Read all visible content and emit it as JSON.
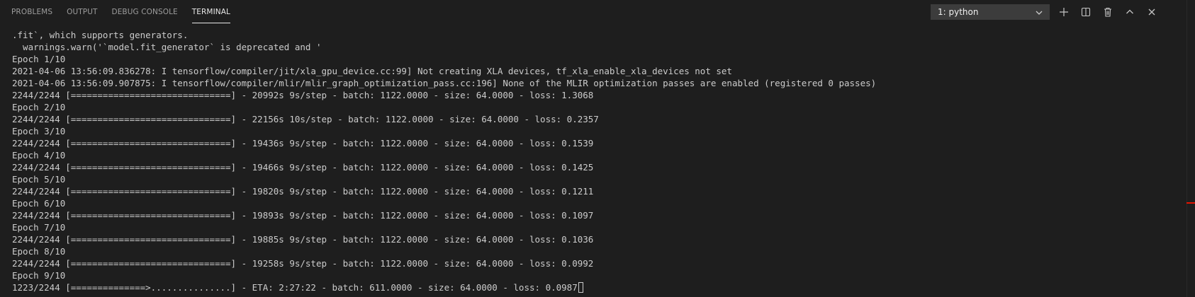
{
  "panel": {
    "tabs": [
      {
        "label": "PROBLEMS"
      },
      {
        "label": "OUTPUT"
      },
      {
        "label": "DEBUG CONSOLE"
      },
      {
        "label": "TERMINAL"
      }
    ],
    "active_tab": "TERMINAL",
    "terminal_select": {
      "selected": "1: python"
    },
    "actions": [
      {
        "name": "new-terminal",
        "icon": "plus-icon"
      },
      {
        "name": "split-terminal",
        "icon": "split-icon"
      },
      {
        "name": "kill-terminal",
        "icon": "trash-icon"
      },
      {
        "name": "maximize-panel",
        "icon": "chevron-up-icon"
      },
      {
        "name": "close-panel",
        "icon": "close-icon"
      }
    ]
  },
  "terminal": {
    "lines": [
      ".fit`, which supports generators.",
      "  warnings.warn('`model.fit_generator` is deprecated and '",
      "Epoch 1/10",
      "2021-04-06 13:56:09.836278: I tensorflow/compiler/jit/xla_gpu_device.cc:99] Not creating XLA devices, tf_xla_enable_xla_devices not set",
      "2021-04-06 13:56:09.907875: I tensorflow/compiler/mlir/mlir_graph_optimization_pass.cc:196] None of the MLIR optimization passes are enabled (registered 0 passes)",
      "2244/2244 [==============================] - 20992s 9s/step - batch: 1122.0000 - size: 64.0000 - loss: 1.3068",
      "Epoch 2/10",
      "2244/2244 [==============================] - 22156s 10s/step - batch: 1122.0000 - size: 64.0000 - loss: 0.2357",
      "Epoch 3/10",
      "2244/2244 [==============================] - 19436s 9s/step - batch: 1122.0000 - size: 64.0000 - loss: 0.1539",
      "Epoch 4/10",
      "2244/2244 [==============================] - 19466s 9s/step - batch: 1122.0000 - size: 64.0000 - loss: 0.1425",
      "Epoch 5/10",
      "2244/2244 [==============================] - 19820s 9s/step - batch: 1122.0000 - size: 64.0000 - loss: 0.1211",
      "Epoch 6/10",
      "2244/2244 [==============================] - 19893s 9s/step - batch: 1122.0000 - size: 64.0000 - loss: 0.1097",
      "Epoch 7/10",
      "2244/2244 [==============================] - 19885s 9s/step - batch: 1122.0000 - size: 64.0000 - loss: 0.1036",
      "Epoch 8/10",
      "2244/2244 [==============================] - 19258s 9s/step - batch: 1122.0000 - size: 64.0000 - loss: 0.0992",
      "Epoch 9/10"
    ],
    "current_line": "1223/2244 [==============>...............] - ETA: 2:27:22 - batch: 611.0000 - size: 64.0000 - loss: 0.0987"
  },
  "colors": {
    "background": "#1e1e1e",
    "text": "#cccccc",
    "tab_inactive": "#9d9d9d",
    "tab_active": "#e7e7e7",
    "select_bg": "#3c3c3c",
    "scroll_marker": "#e51400"
  }
}
